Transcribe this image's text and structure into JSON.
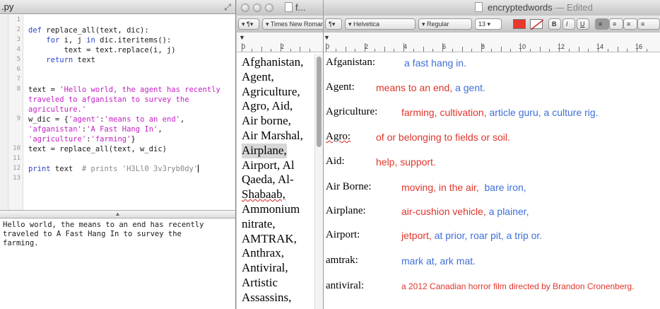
{
  "editor": {
    "title": ".py",
    "line_numbers": [
      "1",
      "2",
      "3",
      "4",
      "5",
      "6",
      "7",
      "8",
      "9",
      "10",
      "11",
      "12",
      "13"
    ],
    "code": {
      "l2_kw": "def",
      "l2_rest": " replace_all(text, dic):",
      "l3_a": "    ",
      "l3_kw1": "for",
      "l3_b": " i, j ",
      "l3_kw2": "in",
      "l3_c": " dic.iteritems():",
      "l4": "        text = text.replace(i, j)",
      "l5_a": "    ",
      "l5_kw": "return",
      "l5_b": " text",
      "l8_a": "text = ",
      "l8_s1": "'Hello world, the agent has recently",
      "l8_s2": "traveled to afganistan to survey the",
      "l8_s3": "agriculture.'",
      "l9_a": "w_dic = {",
      "l9_s1": "'agent'",
      "l9_b": ":",
      "l9_s2": "'means to an end'",
      "l9_c": ",",
      "l9_s3": "'afganistan'",
      "l9_d": ":",
      "l9_s4": "'A Fast Hang In'",
      "l9_e": ",",
      "l9_s5": "'agriculture'",
      "l9_f": ":",
      "l9_s6": "'farming'",
      "l9_g": "}",
      "l11": "text = replace_all(text, w_dic)",
      "l13_kw": "print",
      "l13_a": " text  ",
      "l13_cmt": "# prints 'H3Ll0 3v3ryb0dy'"
    },
    "output": "Hello world, the means to an end has recently\ntraveled to A Fast Hang In to survey the\nfarming."
  },
  "textedit_left": {
    "title": "f...",
    "font_name": "Times New Roman",
    "ruler_numbers": [
      "0",
      "2"
    ],
    "words": [
      "Afghanistan,",
      "Agent,",
      "Agriculture,",
      "Agro, Aid,",
      "Air borne,",
      "Air Marshal,",
      "Airplane,",
      "Airport, Al",
      "Qaeda, Al-",
      "Shabaab,",
      "Ammonium",
      "nitrate,",
      "AMTRAK,",
      "Anthrax,",
      "Antiviral,",
      "Artistic",
      "Assassins,"
    ]
  },
  "textedit_right": {
    "title": "encryptedwords",
    "status": "Edited",
    "toolbar": {
      "font_family": "Helvetica",
      "font_style": "Regular",
      "font_size": "13",
      "text_color": "#e8372b",
      "bold": "B",
      "italic": "I",
      "underline": "U"
    },
    "ruler_numbers": [
      "0",
      "2",
      "4",
      "6",
      "8",
      "10",
      "12",
      "14",
      "16"
    ],
    "entries": [
      {
        "term": "Afganistan:",
        "red": "",
        "blue": "a fast hang in."
      },
      {
        "term": "Agent:",
        "red": "means to an end,",
        "blue": "a gent."
      },
      {
        "term": "Agriculture:",
        "red": "farming, cultivation,",
        "blue": "article guru, a culture rig."
      },
      {
        "term": "Agro:",
        "red": "of or belonging to fields or soil.",
        "blue": ""
      },
      {
        "term": "Aid:",
        "red": "help, support.",
        "blue": ""
      },
      {
        "term": "Air Borne:",
        "red": "moving, in the air,",
        "blue": "bare iron,"
      },
      {
        "term": "Airplane:",
        "red": "air-cushion vehicle,",
        "blue": "a plainer,"
      },
      {
        "term": "Airport:",
        "red": "jetport,",
        "blue": "at prior, roar pit, a trip or."
      },
      {
        "term": "amtrak:",
        "red": "",
        "blue": "mark at, ark mat."
      },
      {
        "term": "antiviral:",
        "red": "a 2012 Canadian horror film directed by Brandon Cronenberg.",
        "blue": ""
      }
    ]
  },
  "colors": {
    "keyword": "#2a46c8",
    "string": "#c421c4",
    "definition_red": "#e0352b",
    "definition_blue": "#3f6fd8"
  }
}
